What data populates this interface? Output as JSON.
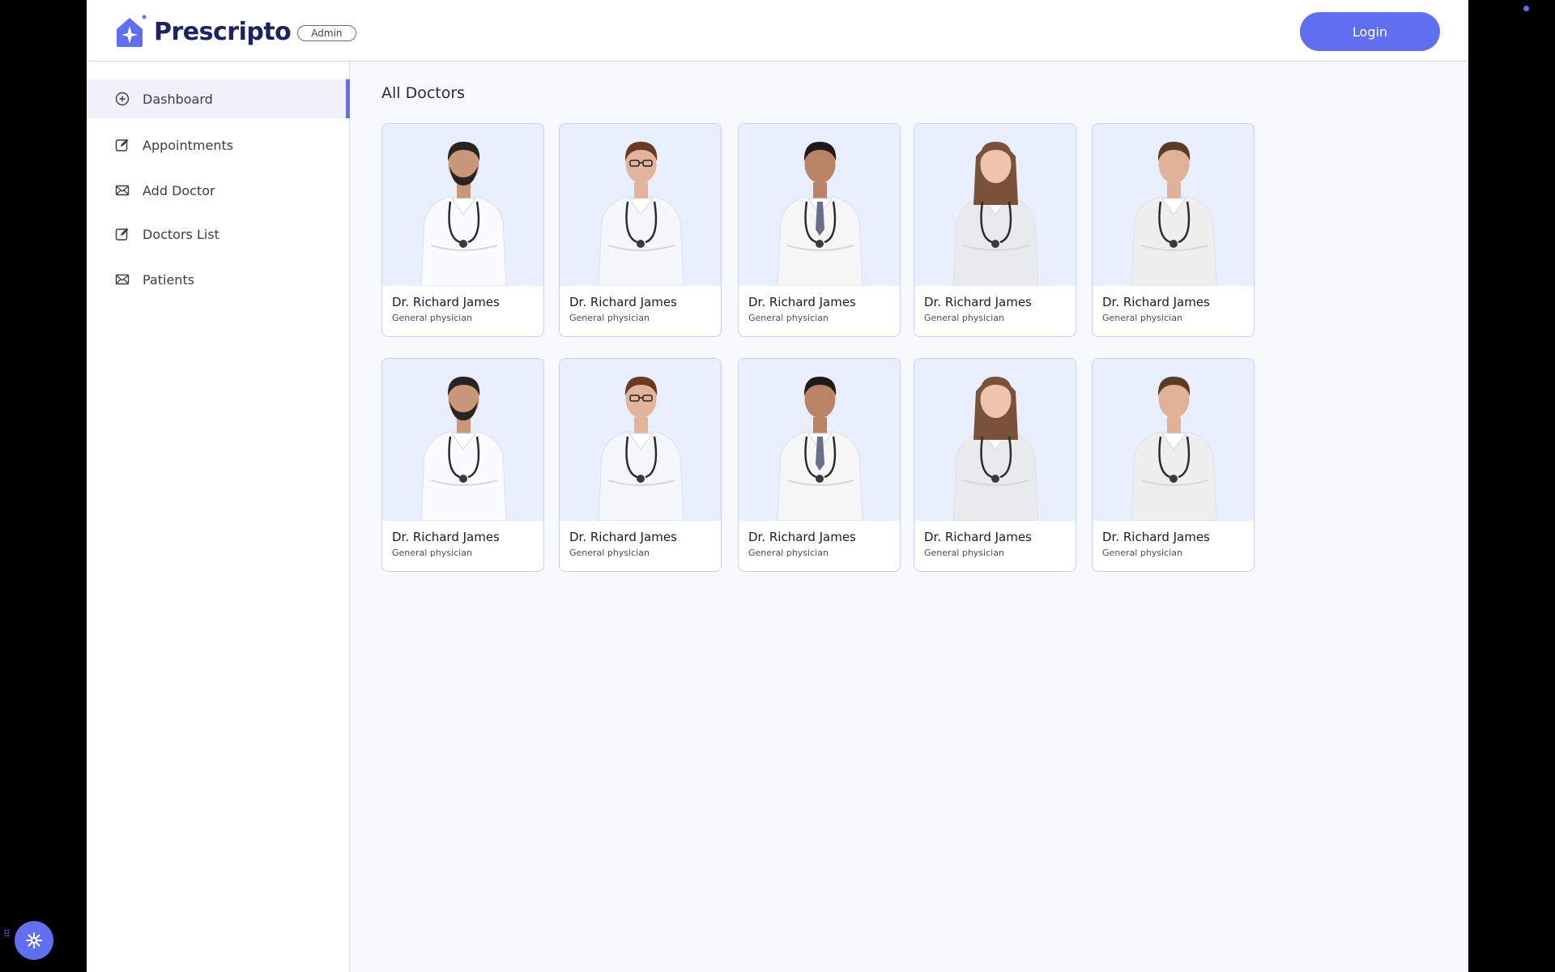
{
  "brand": {
    "name": "Prescripto",
    "badge": "Admin",
    "accent": "#5f6ff0"
  },
  "header": {
    "login_label": "Login"
  },
  "sidebar": {
    "items": [
      {
        "label": "Dashboard",
        "icon": "home-plus-icon",
        "active": true
      },
      {
        "label": "Appointments",
        "icon": "edit-icon",
        "active": false
      },
      {
        "label": "Add Doctor",
        "icon": "mail-icon",
        "active": false
      },
      {
        "label": "Doctors List",
        "icon": "edit-icon",
        "active": false
      },
      {
        "label": "Patients",
        "icon": "mail-icon",
        "active": false
      }
    ]
  },
  "main": {
    "title": "All Doctors",
    "doctors": [
      {
        "name": "Dr. Richard James",
        "speciality": "General physician",
        "photo": "male-doctor-beard"
      },
      {
        "name": "Dr. Richard James",
        "speciality": "General physician",
        "photo": "female-doctor-glasses"
      },
      {
        "name": "Dr. Richard James",
        "speciality": "General physician",
        "photo": "male-doctor-tie"
      },
      {
        "name": "Dr. Richard James",
        "speciality": "General physician",
        "photo": "female-doctor-clipboard"
      },
      {
        "name": "Dr. Richard James",
        "speciality": "General physician",
        "photo": "young-male-doctor"
      },
      {
        "name": "Dr. Richard James",
        "speciality": "General physician",
        "photo": "male-doctor-beard"
      },
      {
        "name": "Dr. Richard James",
        "speciality": "General physician",
        "photo": "female-doctor-glasses"
      },
      {
        "name": "Dr. Richard James",
        "speciality": "General physician",
        "photo": "male-doctor-tie"
      },
      {
        "name": "Dr. Richard James",
        "speciality": "General physician",
        "photo": "female-doctor-clipboard"
      },
      {
        "name": "Dr. Richard James",
        "speciality": "General physician",
        "photo": "young-male-doctor"
      }
    ]
  }
}
